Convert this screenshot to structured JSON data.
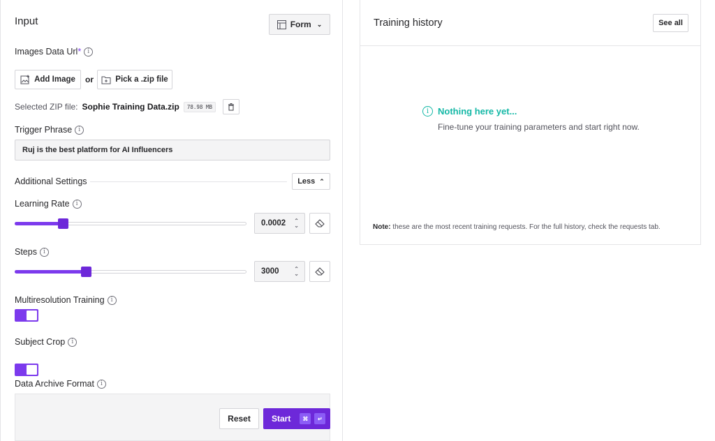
{
  "input": {
    "title": "Input",
    "form_select": {
      "label": "Form",
      "icon": "layout-icon"
    },
    "images_data_url": {
      "label": "Images Data Url",
      "required_mark": "*"
    },
    "add_image_label": "Add Image",
    "or_label": "or",
    "pick_zip_label": "Pick a .zip file",
    "selected_zip": {
      "prefix": "Selected ZIP file:",
      "filename": "Sophie Training Data.zip",
      "size": "78.98 MB"
    },
    "trigger_phrase": {
      "label": "Trigger Phrase",
      "value": "Ruj is the best platform for AI Influencers"
    },
    "additional_settings": {
      "label": "Additional Settings",
      "toggle_label": "Less"
    },
    "learning_rate": {
      "label": "Learning Rate",
      "value": "0.0002",
      "fill_fraction": 0.21
    },
    "steps": {
      "label": "Steps",
      "value": "3000",
      "fill_fraction": 0.31
    },
    "multiresolution": {
      "label": "Multiresolution Training",
      "enabled": true
    },
    "subject_crop": {
      "label": "Subject Crop",
      "enabled": true
    },
    "data_archive_format": {
      "label": "Data Archive Format"
    },
    "reset_label": "Reset",
    "start_label": "Start",
    "start_kbd": [
      "⌘",
      "↵"
    ]
  },
  "history": {
    "title": "Training history",
    "see_all_label": "See all",
    "empty_title": "Nothing here yet...",
    "empty_text": "Fine-tune your training parameters and start right now.",
    "note_prefix": "Note:",
    "note_text": "these are the most recent training requests. For the full history, check the requests tab."
  },
  "colors": {
    "accent": "#7c3aed",
    "empty_title": "#14b8a6"
  }
}
